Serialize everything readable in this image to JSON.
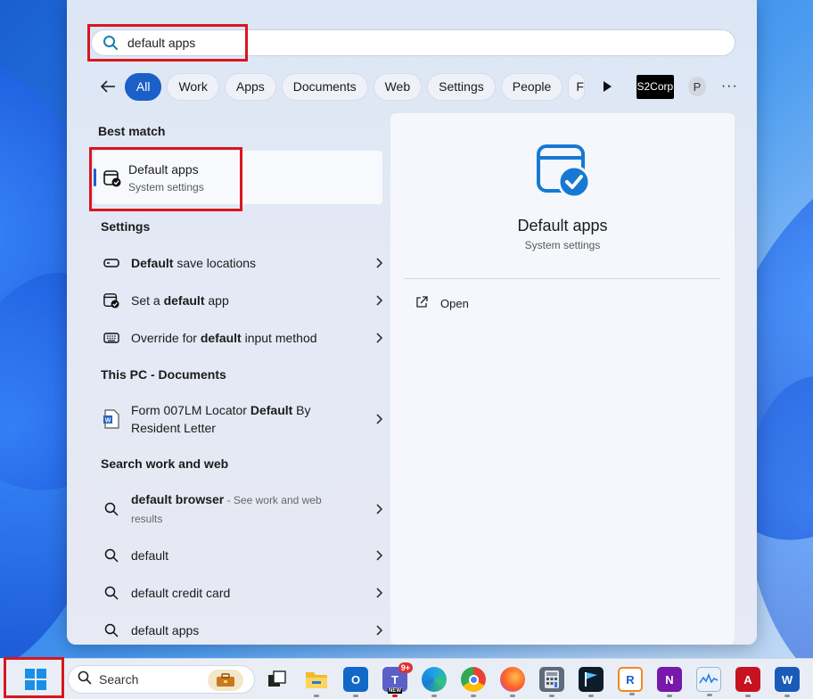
{
  "search": {
    "query": "default apps"
  },
  "filters": {
    "chips": [
      {
        "label": "All",
        "active": true
      },
      {
        "label": "Work",
        "active": false
      },
      {
        "label": "Apps",
        "active": false
      },
      {
        "label": "Documents",
        "active": false
      },
      {
        "label": "Web",
        "active": false
      },
      {
        "label": "Settings",
        "active": false
      },
      {
        "label": "People",
        "active": false
      },
      {
        "label": "F",
        "active": false
      }
    ],
    "org_badge": "S2Corp",
    "avatar_initial": "P",
    "more": "···"
  },
  "best_match": {
    "section_title": "Best match",
    "name": "Default apps",
    "kind": "System settings"
  },
  "settings_section": {
    "title": "Settings",
    "items": [
      {
        "pre": "",
        "bold": "Default",
        "post": " save locations",
        "icon": "drive-icon"
      },
      {
        "pre": "Set a ",
        "bold": "default",
        "post": " app",
        "icon": "default-apps-icon"
      },
      {
        "pre": "Override for ",
        "bold": "default",
        "post": " input method",
        "icon": "keyboard-icon"
      }
    ]
  },
  "documents_section": {
    "title": "This PC - Documents",
    "item": {
      "pre": "Form 007LM Locator ",
      "bold": "Default",
      "post": " By",
      "line2": "Resident Letter",
      "icon": "word-doc-icon"
    }
  },
  "web_section": {
    "title": "Search work and web",
    "items": [
      {
        "bold": "default browser",
        "suffix": " - See work and web",
        "line2": "results"
      },
      {
        "bold": "",
        "text": "default"
      },
      {
        "bold": "",
        "text": "default credit card"
      },
      {
        "bold": "",
        "text": "default apps"
      }
    ]
  },
  "preview": {
    "name": "Default apps",
    "kind": "System settings",
    "open_label": "Open"
  },
  "taskbar": {
    "search_label": "Search",
    "teams_badge": "9+",
    "teams_new": "NEW"
  },
  "colors": {
    "accent": "#1b5fc9",
    "highlight_box": "#d9161f"
  }
}
